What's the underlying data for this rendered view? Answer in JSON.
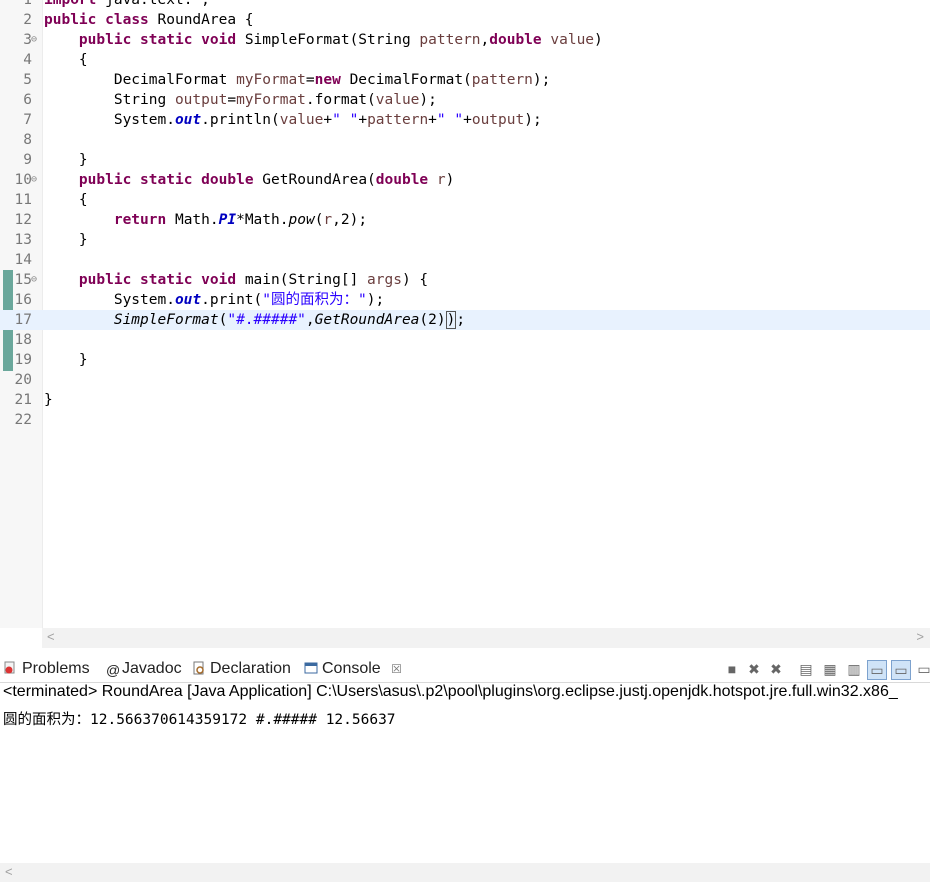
{
  "editor": {
    "lines": [
      {
        "n": "1",
        "fold": "",
        "parts": [
          [
            "kw",
            "import"
          ],
          [
            "t",
            " java.text.*;"
          ]
        ]
      },
      {
        "n": "2",
        "fold": "",
        "parts": [
          [
            "kw",
            "public"
          ],
          [
            "t",
            " "
          ],
          [
            "kw",
            "class"
          ],
          [
            "t",
            " RoundArea {"
          ]
        ]
      },
      {
        "n": "3",
        "fold": "⊖",
        "parts": [
          [
            "t",
            "    "
          ],
          [
            "kw",
            "public"
          ],
          [
            "t",
            " "
          ],
          [
            "kw",
            "static"
          ],
          [
            "t",
            " "
          ],
          [
            "kw",
            "void"
          ],
          [
            "t",
            " SimpleFormat(String "
          ],
          [
            "par",
            "pattern"
          ],
          [
            "t",
            ","
          ],
          [
            "kw",
            "double"
          ],
          [
            "t",
            " "
          ],
          [
            "par",
            "value"
          ],
          [
            "t",
            ")"
          ]
        ]
      },
      {
        "n": "4",
        "fold": "",
        "parts": [
          [
            "t",
            "    {"
          ]
        ]
      },
      {
        "n": "5",
        "fold": "",
        "parts": [
          [
            "t",
            "        DecimalFormat "
          ],
          [
            "var",
            "myFormat"
          ],
          [
            "t",
            "="
          ],
          [
            "kw",
            "new"
          ],
          [
            "t",
            " DecimalFormat("
          ],
          [
            "var",
            "pattern"
          ],
          [
            "t",
            ");"
          ]
        ]
      },
      {
        "n": "6",
        "fold": "",
        "parts": [
          [
            "t",
            "        String "
          ],
          [
            "var",
            "output"
          ],
          [
            "t",
            "="
          ],
          [
            "var",
            "myFormat"
          ],
          [
            "t",
            ".format("
          ],
          [
            "var",
            "value"
          ],
          [
            "t",
            ");"
          ]
        ]
      },
      {
        "n": "7",
        "fold": "",
        "parts": [
          [
            "t",
            "        System."
          ],
          [
            "fld",
            "out"
          ],
          [
            "t",
            ".println("
          ],
          [
            "var",
            "value"
          ],
          [
            "t",
            "+"
          ],
          [
            "str",
            "\" \""
          ],
          [
            "t",
            "+"
          ],
          [
            "var",
            "pattern"
          ],
          [
            "t",
            "+"
          ],
          [
            "str",
            "\" \""
          ],
          [
            "t",
            "+"
          ],
          [
            "var",
            "output"
          ],
          [
            "t",
            ");"
          ]
        ]
      },
      {
        "n": "8",
        "fold": "",
        "parts": [
          [
            "t",
            ""
          ]
        ]
      },
      {
        "n": "9",
        "fold": "",
        "parts": [
          [
            "t",
            "    }"
          ]
        ]
      },
      {
        "n": "10",
        "fold": "⊖",
        "parts": [
          [
            "t",
            "    "
          ],
          [
            "kw",
            "public"
          ],
          [
            "t",
            " "
          ],
          [
            "kw",
            "static"
          ],
          [
            "t",
            " "
          ],
          [
            "kw",
            "double"
          ],
          [
            "t",
            " GetRoundArea("
          ],
          [
            "kw",
            "double"
          ],
          [
            "t",
            " "
          ],
          [
            "par",
            "r"
          ],
          [
            "t",
            ")"
          ]
        ]
      },
      {
        "n": "11",
        "fold": "",
        "parts": [
          [
            "t",
            "    {"
          ]
        ]
      },
      {
        "n": "12",
        "fold": "",
        "parts": [
          [
            "t",
            "        "
          ],
          [
            "kw",
            "return"
          ],
          [
            "t",
            " Math."
          ],
          [
            "sfld",
            "PI"
          ],
          [
            "t",
            "*Math."
          ],
          [
            "smth",
            "pow"
          ],
          [
            "t",
            "("
          ],
          [
            "par",
            "r"
          ],
          [
            "t",
            ",2);"
          ]
        ]
      },
      {
        "n": "13",
        "fold": "",
        "parts": [
          [
            "t",
            "    }"
          ]
        ]
      },
      {
        "n": "14",
        "fold": "",
        "parts": [
          [
            "t",
            ""
          ]
        ]
      },
      {
        "n": "15",
        "fold": "⊖",
        "parts": [
          [
            "t",
            "    "
          ],
          [
            "kw",
            "public"
          ],
          [
            "t",
            " "
          ],
          [
            "kw",
            "static"
          ],
          [
            "t",
            " "
          ],
          [
            "kw",
            "void"
          ],
          [
            "t",
            " main(String[] "
          ],
          [
            "par",
            "args"
          ],
          [
            "t",
            ") {"
          ]
        ]
      },
      {
        "n": "16",
        "fold": "",
        "parts": [
          [
            "t",
            "        System."
          ],
          [
            "fld",
            "out"
          ],
          [
            "t",
            ".print("
          ],
          [
            "str",
            "\"圆的面积为：\""
          ],
          [
            "t",
            ");"
          ]
        ]
      },
      {
        "n": "17",
        "fold": "",
        "current": true,
        "parts": [
          [
            "t",
            "        "
          ],
          [
            "smth",
            "SimpleFormat"
          ],
          [
            "t",
            "("
          ],
          [
            "str",
            "\"#.#####\""
          ],
          [
            "t",
            ","
          ],
          [
            "smth",
            "GetRoundArea"
          ],
          [
            "t",
            "(2)"
          ],
          [
            "caret",
            ")"
          ],
          [
            "t",
            ";"
          ]
        ]
      },
      {
        "n": "18",
        "fold": "",
        "parts": [
          [
            "t",
            ""
          ]
        ]
      },
      {
        "n": "19",
        "fold": "",
        "parts": [
          [
            "t",
            "    }"
          ]
        ]
      },
      {
        "n": "20",
        "fold": "",
        "parts": [
          [
            "t",
            ""
          ]
        ]
      },
      {
        "n": "21",
        "fold": "",
        "parts": [
          [
            "t",
            "}"
          ]
        ]
      },
      {
        "n": "22",
        "fold": "",
        "parts": [
          [
            "t",
            ""
          ]
        ]
      }
    ]
  },
  "tabs": [
    {
      "label": "Problems",
      "icon": "problems-icon"
    },
    {
      "label": "Javadoc",
      "icon": "javadoc-icon"
    },
    {
      "label": "Declaration",
      "icon": "declaration-icon"
    },
    {
      "label": "Console",
      "icon": "console-icon",
      "active": true
    }
  ],
  "console": {
    "process": "<terminated> RoundArea [Java Application] C:\\Users\\asus\\.p2\\pool\\plugins\\org.eclipse.justj.openjdk.hotspot.jre.full.win32.x86_",
    "output": "圆的面积为：12.566370614359172 #.##### 12.56637"
  },
  "scroll_left": "<",
  "scroll_right": ">",
  "colors": {
    "keyword": "#7f0055",
    "string": "#2a00ff",
    "field": "#0000c0",
    "variable": "#6a3e3e",
    "current_line": "#e8f2fe"
  }
}
